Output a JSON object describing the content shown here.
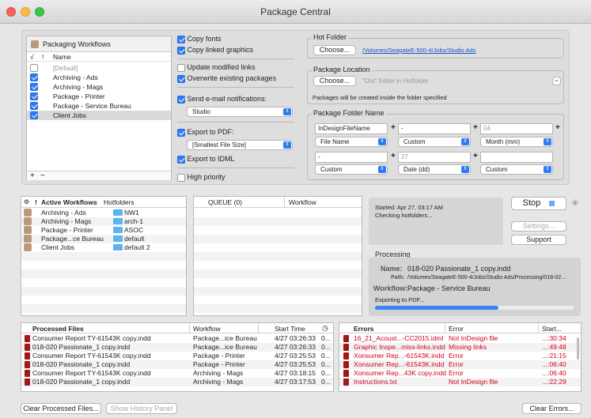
{
  "window": {
    "title": "Package Central"
  },
  "workflows": {
    "header": "Packaging Workflows",
    "col_check": "√",
    "col_bang": "!",
    "col_name": "Name",
    "items": [
      {
        "name": "[Default]",
        "checked": false,
        "gray": true
      },
      {
        "name": "Archiving - Ads",
        "checked": true
      },
      {
        "name": "Archiving - Mags",
        "checked": true
      },
      {
        "name": "Package - Printer",
        "checked": true
      },
      {
        "name": "Package - Service Bureau",
        "checked": true
      },
      {
        "name": "Client Jobs",
        "checked": true
      }
    ],
    "add": "+",
    "remove": "−"
  },
  "options": {
    "copy_fonts": "Copy fonts",
    "copy_linked": "Copy linked graphics",
    "update_links": "Update modified links",
    "overwrite": "Overwrite existing packages",
    "send_email": "Send e-mail notifications:",
    "email_value": "Studio",
    "export_pdf": "Export to PDF:",
    "pdf_value": "[Smallest File Size]",
    "export_idml": "Export to IDML",
    "high_priority": "High priority"
  },
  "hot_folder": {
    "title": "Hot Folder",
    "choose": "Choose...",
    "path": "/Volumes/SeagateE-500-4/Jobs/Studio Ads"
  },
  "package_location": {
    "title": "Package Location",
    "choose": "Choose...",
    "placeholder": "\"Out\" folder in Hotfolder",
    "minus": "−",
    "note": "Packages will be created inside the folder specified"
  },
  "package_folder_name": {
    "title": "Package Folder Name",
    "f1": "InDesignFileName",
    "f2": "-",
    "f3": "04",
    "f4": "-",
    "f5": "27",
    "f6": "",
    "plus": "+",
    "s1": "File Name",
    "s2": "Custom",
    "s3": "Month (mm)",
    "s4": "Custom",
    "s5": "Date (dd)",
    "s6": "Custom"
  },
  "active_workflows": {
    "col_bang": "!",
    "col_name": "Active Workflows",
    "col_hot": "Hotfolders",
    "items": [
      {
        "name": "Archiving - Ads",
        "folder": "NW1"
      },
      {
        "name": "Archiving - Mags",
        "folder": "arch-1"
      },
      {
        "name": "Package - Printer",
        "folder": "ASOC"
      },
      {
        "name": "Package...ce Bureau",
        "folder": "default"
      },
      {
        "name": "Client Jobs",
        "folder": "default 2"
      }
    ]
  },
  "queue": {
    "col_queue": "QUEUE (0)",
    "col_workflow": "Workflow"
  },
  "status": {
    "started": "Started: Apr 27, 03:17 AM",
    "checking": "Checking hotfolders...",
    "stop": "Stop",
    "settings": "Settings...",
    "support": "Support"
  },
  "processing": {
    "title": "Processing",
    "name_label": "Name:",
    "name_value": "018-020 Passionate_1 copy.indd",
    "path_label": "Path:",
    "path_value": "/Volumes/SeagateE-500-4/Jobs/Studio Ads/Processing/018-02...",
    "workflow_label": "Workflow:",
    "workflow_value": "Package - Service Bureau",
    "exporting": "Exporting to PDF...",
    "progress": 0.62
  },
  "processed": {
    "col_file": "Processed Files",
    "col_workflow": "Workflow",
    "col_start": "Start Time",
    "rows": [
      {
        "file": "Consumer Report TY-61543K copy.indd",
        "workflow": "Package...ice Bureau",
        "time": "4/27 03:26:33",
        "x": "0..."
      },
      {
        "file": "018-020 Passionate_1 copy.indd",
        "workflow": "Package...ice Bureau",
        "time": "4/27 03:26:33",
        "x": "0..."
      },
      {
        "file": "Consumer Report TY-61543K copy.indd",
        "workflow": "Package - Printer",
        "time": "4/27 03:25:53",
        "x": "0..."
      },
      {
        "file": "018-020 Passionate_1 copy.indd",
        "workflow": "Package - Printer",
        "time": "4/27 03:25:53",
        "x": "0..."
      },
      {
        "file": "Consumer Report TY-61543K copy.indd",
        "workflow": "Archiving - Mags",
        "time": "4/27 03:18:15",
        "x": "0..."
      },
      {
        "file": "018-020 Passionate_1 copy.indd",
        "workflow": "Archiving - Mags",
        "time": "4/27 03:17:53",
        "x": "0..."
      }
    ]
  },
  "errors": {
    "col_errors": "Errors",
    "col_error": "Error",
    "col_start": "Start...",
    "rows": [
      {
        "file": "16_21_Acoust...-CC2015.idml",
        "error": "Not InDesign file",
        "time": "...:30:34"
      },
      {
        "file": "Graphic Inspe...miss-links.indd",
        "error": "Missing links",
        "time": "...:49:48"
      },
      {
        "file": "Xonsumer Rep...-61543K.indd",
        "error": "Error",
        "time": "...:21:15"
      },
      {
        "file": "Xonsumer Rep...-61543K.indd",
        "error": "Error",
        "time": "...:06:40"
      },
      {
        "file": "Xonsumer Rep...43K copy.indd",
        "error": "Error",
        "time": "...:06:40"
      },
      {
        "file": "Instructions.txt",
        "error": "Not InDesign file",
        "time": "...:22:29"
      }
    ]
  },
  "footer": {
    "clear_processed": "Clear Processed Files...",
    "show_history": "Show History Panel",
    "clear_errors": "Clear Errors..."
  }
}
